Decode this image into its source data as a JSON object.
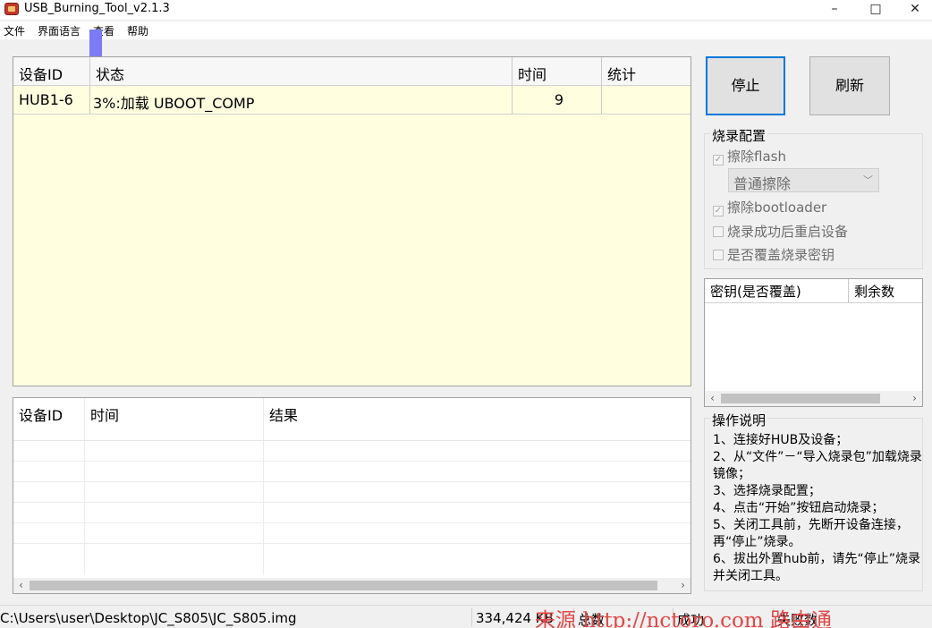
{
  "window": {
    "title": "USB_Burning_Tool_v2.1.3",
    "minimize": "–",
    "maximize": "□",
    "close": "✕"
  },
  "menu": [
    "文件",
    "界面语言",
    "查看",
    "帮助"
  ],
  "device_table": {
    "columns": [
      "设备ID",
      "状态",
      "时间",
      "统计"
    ],
    "rows": [
      {
        "device_id": "HUB1-6",
        "status": "3%:加载 UBOOT_COMP",
        "time": "9",
        "stats": ""
      }
    ],
    "progress_percent": 3
  },
  "log_table": {
    "columns": [
      "设备ID",
      "时间",
      "结果"
    ]
  },
  "buttons": {
    "stop": "停止",
    "refresh": "刷新"
  },
  "burn_config": {
    "title": "烧录配置",
    "erase_flash": {
      "label": "擦除flash",
      "checked": true
    },
    "erase_mode": "普通擦除",
    "erase_bootloader": {
      "label": "擦除bootloader",
      "checked": true
    },
    "reboot_after_success": {
      "label": "烧录成功后重启设备",
      "checked": false
    },
    "overwrite_key": {
      "label": "是否覆盖烧录密钥",
      "checked": false
    }
  },
  "key_table": {
    "columns": [
      "密钥(是否覆盖)",
      "剩余数"
    ]
  },
  "instructions": {
    "title": "操作说明",
    "lines": [
      "1、连接好HUB及设备；",
      "2、从“文件”－“导入烧录包”加载烧录镜像；",
      "3、选择烧录配置；",
      "4、点击“开始”按钮启动烧录；",
      "5、关闭工具前，先断开设备连接，再“停止”烧录。",
      "6、拔出外置hub前，请先“停止”烧录并关闭工具。"
    ]
  },
  "status_bar": {
    "path": "C:\\Users\\user\\Desktop\\JC_S805\\JC_S805.img",
    "size": "334,424 KB",
    "total_label": "总数",
    "success_label": "成功",
    "fail_label": "失败数"
  },
  "watermark": "来源 http://nctoro.com 路由通"
}
